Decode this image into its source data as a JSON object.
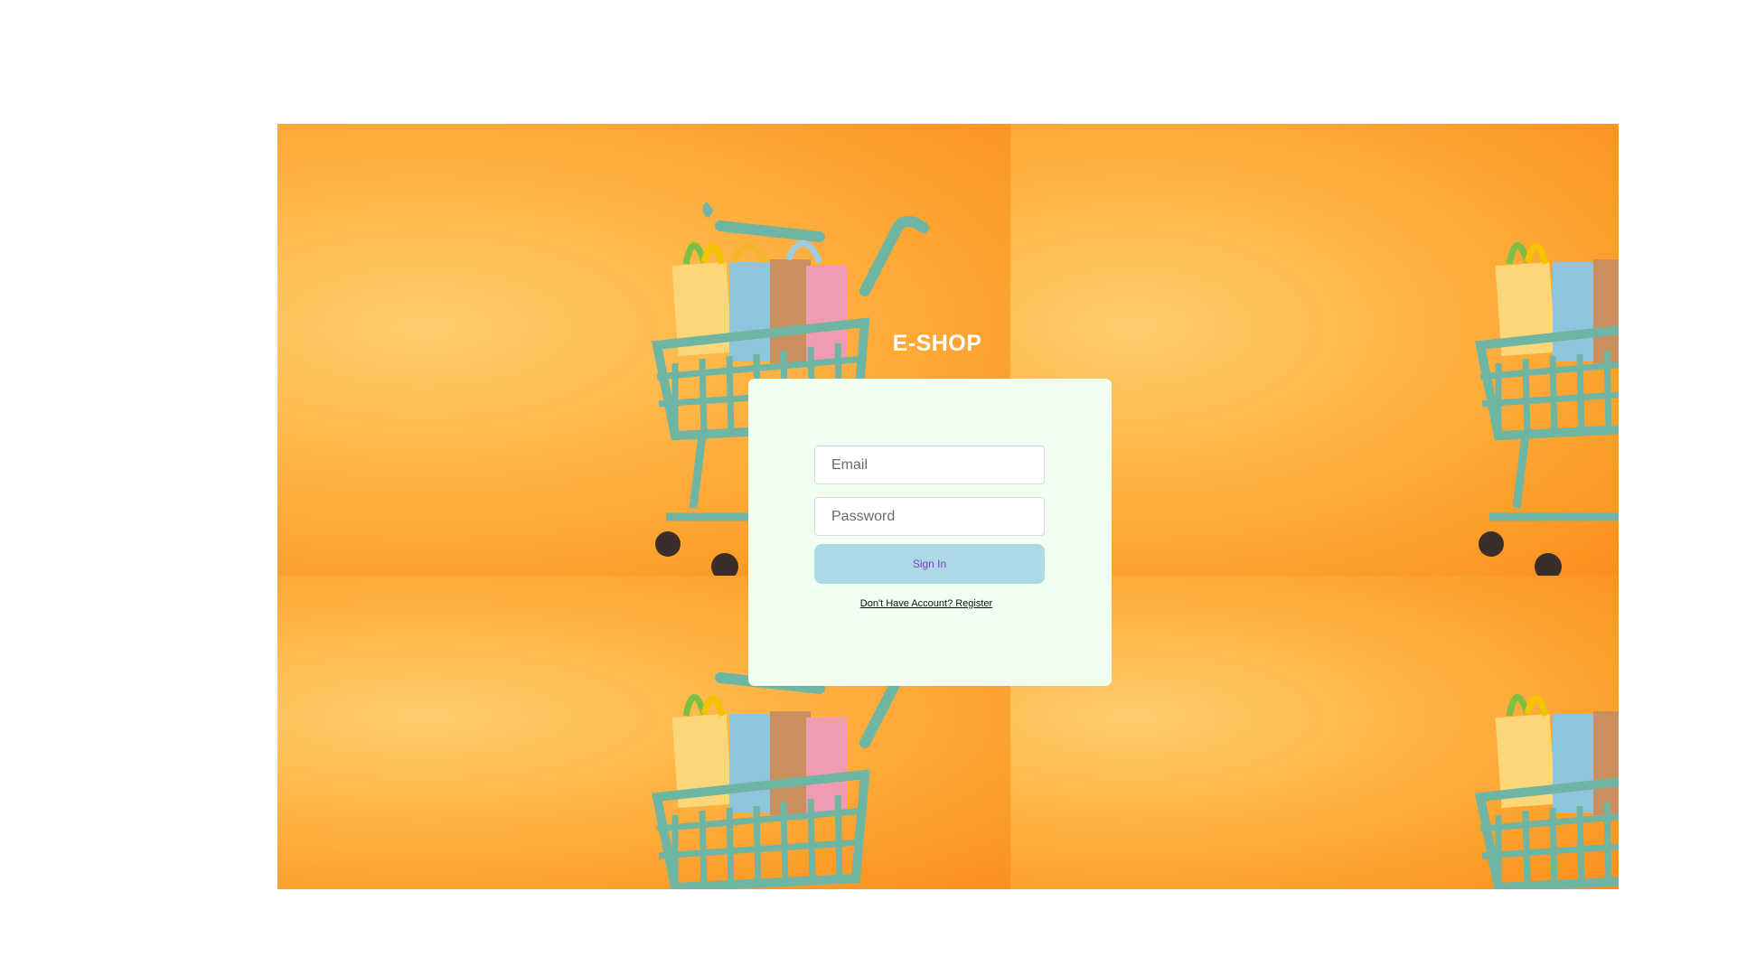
{
  "brand": {
    "title": "E-SHOP"
  },
  "login_form": {
    "email_placeholder": "Email",
    "password_placeholder": "Password",
    "sign_in_label": "Sign In",
    "register_link": "Don't Have Account? Register"
  },
  "colors": {
    "background_orange": "#fda22e",
    "card_background": "#f0fff0",
    "button_background": "#add8e6",
    "button_text": "#7a3fd1",
    "brand_text": "#ffffff"
  },
  "background": {
    "image": "shopping-cart-with-bags-photo",
    "repeat": "tiled"
  }
}
